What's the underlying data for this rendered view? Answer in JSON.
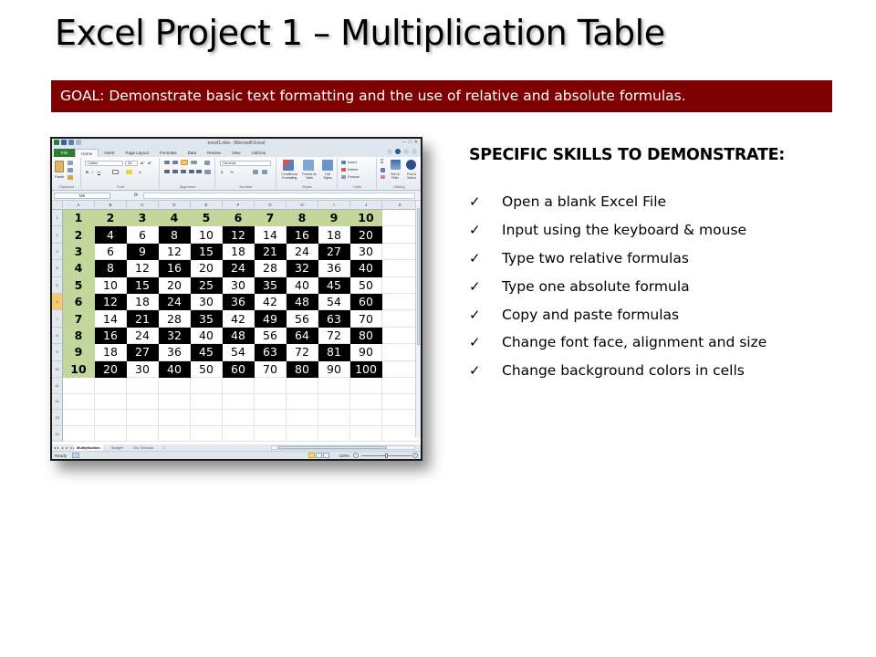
{
  "slide": {
    "title": "Excel Project 1 – Multiplication Table",
    "goal": "GOAL:  Demonstrate basic text formatting and the use of relative and absolute formulas.",
    "goal_bar_color": "#7f0000"
  },
  "skills": {
    "heading": "SPECIFIC SKILLS TO DEMONSTRATE:",
    "check_icon": "✓",
    "items": [
      "Open a blank Excel File",
      "Input using the keyboard & mouse",
      "Type two relative formulas",
      "Type one absolute formula",
      "Copy and paste formulas",
      "Change font face, alignment and size",
      "Change background colors in cells"
    ]
  },
  "excel": {
    "window_title": "excel1.xlsx - Microsoft Excel",
    "window_controls": [
      "–",
      "□",
      "✕"
    ],
    "tabs": [
      "File",
      "Home",
      "Insert",
      "Page Layout",
      "Formulas",
      "Data",
      "Review",
      "View",
      "Add-Ins"
    ],
    "active_tab": "Home",
    "ribbon": {
      "clipboard": {
        "label": "Clipboard",
        "paste": "Paste"
      },
      "font": {
        "label": "Font",
        "font_name": "Calibri",
        "font_size": "26"
      },
      "alignment": {
        "label": "Alignment"
      },
      "number": {
        "label": "Number",
        "format": "General",
        "currency": "$",
        "percent": "%",
        "comma": ","
      },
      "styles": {
        "label": "Styles",
        "conditional": "Conditional Formatting",
        "format_table": "Format as Table",
        "cell_styles": "Cell Styles"
      },
      "cells": {
        "label": "Cells",
        "insert": "Insert",
        "delete": "Delete",
        "format": "Format"
      },
      "editing": {
        "label": "Editing",
        "sort": "Sort & Filter",
        "find": "Find & Select",
        "sum": "Σ"
      }
    },
    "name_box": "M6",
    "fx_label": "fx",
    "formula": "",
    "columns": [
      "A",
      "B",
      "C",
      "D",
      "E",
      "F",
      "G",
      "H",
      "I",
      "J",
      "K"
    ],
    "row_numbers": [
      "1",
      "2",
      "3",
      "4",
      "5",
      "6",
      "7",
      "8",
      "9",
      "10",
      "11",
      "12",
      "13",
      "14"
    ],
    "selected_row": "6",
    "header_color": "#c3d69b",
    "table": [
      [
        1,
        2,
        3,
        4,
        5,
        6,
        7,
        8,
        9,
        10
      ],
      [
        2,
        4,
        6,
        8,
        10,
        12,
        14,
        16,
        18,
        20
      ],
      [
        3,
        6,
        9,
        12,
        15,
        18,
        21,
        24,
        27,
        30
      ],
      [
        4,
        8,
        12,
        16,
        20,
        24,
        28,
        32,
        36,
        40
      ],
      [
        5,
        10,
        15,
        20,
        25,
        30,
        35,
        40,
        45,
        50
      ],
      [
        6,
        12,
        18,
        24,
        30,
        36,
        42,
        48,
        54,
        60
      ],
      [
        7,
        14,
        21,
        28,
        35,
        42,
        49,
        56,
        63,
        70
      ],
      [
        8,
        16,
        24,
        32,
        40,
        48,
        56,
        64,
        72,
        80
      ],
      [
        9,
        18,
        27,
        36,
        45,
        54,
        63,
        72,
        81,
        90
      ],
      [
        10,
        20,
        30,
        40,
        50,
        60,
        70,
        80,
        90,
        100
      ]
    ],
    "sheet_nav": "◂◂ ◂ ▸ ▸▸",
    "sheets": [
      "Multiplication",
      "Budget",
      "Our Schools"
    ],
    "active_sheet": "Multiplication",
    "status": "Ready",
    "zoom": "100%"
  }
}
